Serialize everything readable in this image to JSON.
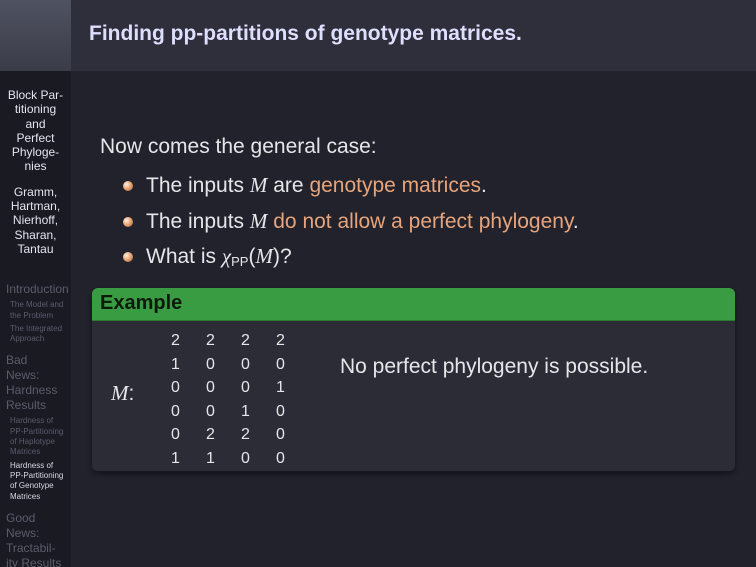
{
  "header": {
    "title": "Finding pp-partitions of genotype matrices."
  },
  "sidebar": {
    "title_lines": [
      "Block Par-",
      "titioning",
      "and",
      "Perfect",
      "Phyloge-",
      "nies"
    ],
    "author_lines": [
      "Gramm,",
      "Hartman,",
      "Nierhoff,",
      "Sharan,",
      "Tantau"
    ],
    "sections": [
      {
        "label": "Introduction",
        "subs": [
          {
            "lines": [
              "The Model and",
              "the Problem"
            ]
          },
          {
            "lines": [
              "The Integrated",
              "Approach"
            ]
          }
        ]
      },
      {
        "label_lines": [
          "Bad",
          "News:",
          "Hardness",
          "Results"
        ],
        "subs": [
          {
            "lines": [
              "Hardness of",
              "PP-Partitioning",
              "of Haplotype",
              "Matrices"
            ]
          },
          {
            "lines": [
              "Hardness of",
              "PP-Partitioning",
              "of Genotype",
              "Matrices"
            ]
          }
        ]
      },
      {
        "label_lines": [
          "Good",
          "News:",
          "Tractabil-",
          "ity Results"
        ]
      }
    ]
  },
  "main": {
    "intro": "Now comes the general case:",
    "b1": {
      "pre": "The inputs ",
      "var": "M",
      "mid": " are ",
      "hl": "genotype matrices",
      "post": "."
    },
    "b2": {
      "pre": "The inputs ",
      "var": "M",
      "mid": " ",
      "hl": "do not allow a perfect phylogeny",
      "post": "."
    },
    "b3": {
      "pre": "What is ",
      "chi": "χ",
      "sub": "PP",
      "open": "(",
      "var": "M",
      "close": ")?"
    }
  },
  "example": {
    "title": "Example",
    "matrix_label": "M",
    "colon": ":",
    "matrix": [
      [
        "2",
        "2",
        "2",
        "2"
      ],
      [
        "1",
        "0",
        "0",
        "0"
      ],
      [
        "0",
        "0",
        "0",
        "1"
      ],
      [
        "0",
        "0",
        "1",
        "0"
      ],
      [
        "0",
        "2",
        "2",
        "0"
      ],
      [
        "1",
        "1",
        "0",
        "0"
      ]
    ],
    "note": "No perfect phylogeny is possible."
  },
  "colors": {
    "accent": "#e7a47a",
    "block_header": "#3a9c42",
    "header_title": "#dedeff"
  }
}
